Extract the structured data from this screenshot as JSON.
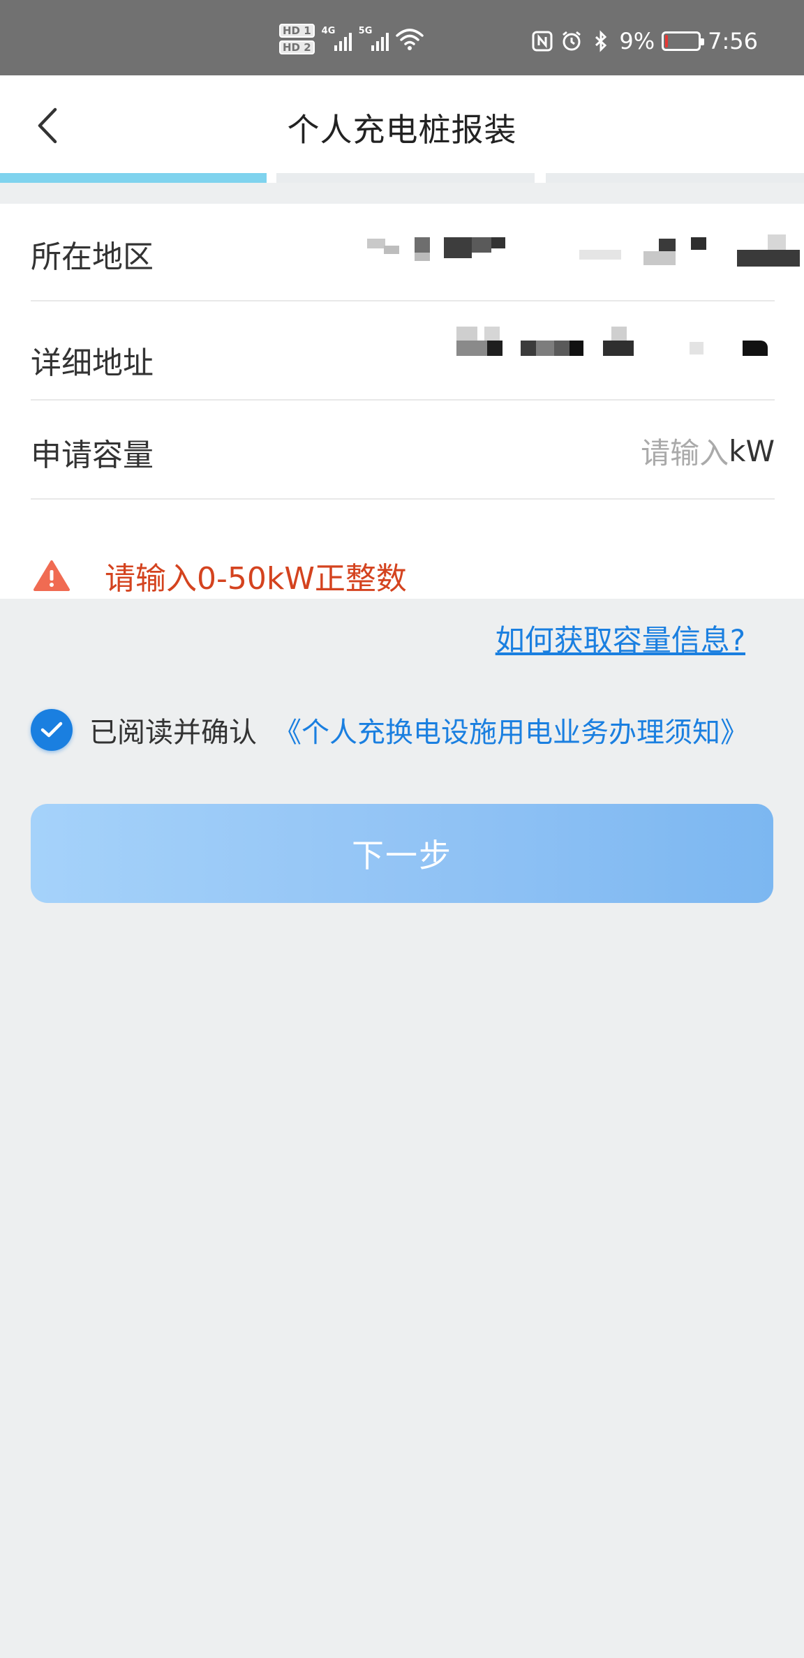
{
  "status_bar": {
    "hd1": "HD 1",
    "hd2": "HD 2",
    "net1": "4G",
    "net2": "5G",
    "battery_percent": "9%",
    "battery_level": 0.09,
    "time": "7:56",
    "icons": [
      "nfc-icon",
      "alarm-icon",
      "bluetooth-icon",
      "wifi-icon",
      "battery-icon"
    ]
  },
  "header": {
    "title": "个人充电桩报装",
    "back_icon": "chevron-left-icon"
  },
  "progress": {
    "current_step": 1,
    "total_steps": 3,
    "active_color": "#7fd3ee"
  },
  "form": {
    "region": {
      "label": "所在地区",
      "value_redacted": true
    },
    "address": {
      "label": "详细地址",
      "value_redacted": true
    },
    "capacity": {
      "label": "申请容量",
      "placeholder": "请输入",
      "unit": "kW"
    },
    "error": {
      "icon": "warning-icon",
      "text": "请输入0-50kW正整数",
      "color": "#d4431f"
    }
  },
  "help_link": "如何获取容量信息?",
  "agreement": {
    "checked": true,
    "prefix": "已阅读并确认",
    "link": "《个人充换电设施用电业务办理须知》"
  },
  "next_button": {
    "label": "下一步",
    "enabled": false
  },
  "colors": {
    "accent": "#1a7fe0",
    "error": "#d4431f",
    "background": "#edeff0"
  }
}
